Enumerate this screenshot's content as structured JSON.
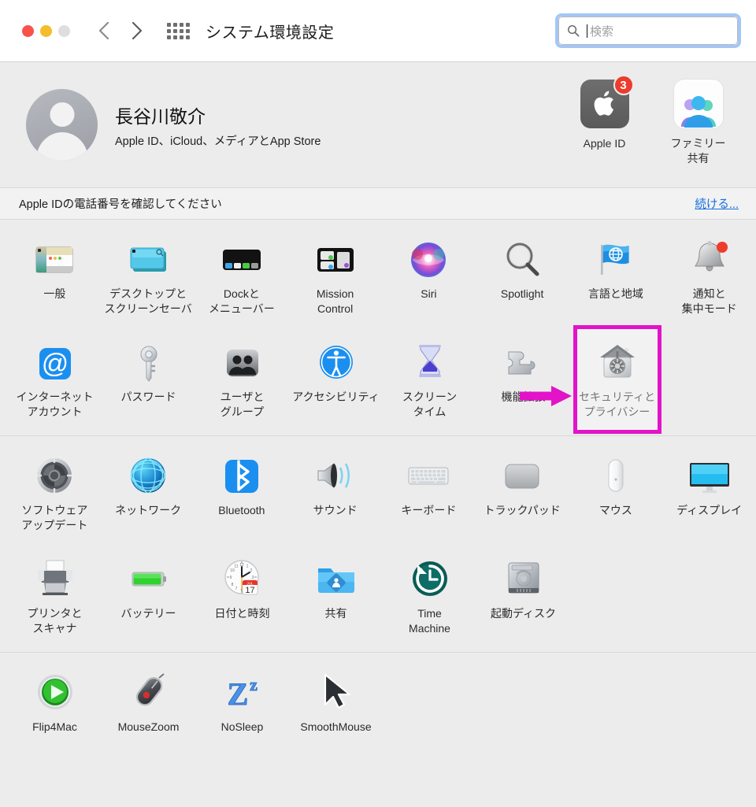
{
  "window": {
    "title": "システム環境設定",
    "traffic_lights": [
      "close-red",
      "minimize-yellow",
      "zoom-gray-disabled"
    ],
    "nav": {
      "back": "back-chevron",
      "forward": "forward-chevron",
      "grid": "show-all-grid"
    }
  },
  "search": {
    "placeholder": "検索",
    "value": "",
    "icon": "search-icon",
    "focus_ring_color": "#a3c7f5"
  },
  "account": {
    "name": "長谷川敬介",
    "subtitle": "Apple ID、iCloud、メディアとApp Store",
    "avatar": "user-placeholder-avatar",
    "apps": [
      {
        "label": "Apple ID",
        "icon": "apple-logo-icon",
        "badge": "3",
        "badge_color": "#ec3c2d"
      },
      {
        "label": "ファミリー\n共有",
        "label_line1": "ファミリー",
        "label_line2": "共有",
        "icon": "family-sharing-icon"
      }
    ]
  },
  "notice": {
    "message": "Apple IDの電話番号を確認してください",
    "action_label": "続ける...",
    "action_color": "#156ce0"
  },
  "annotation": {
    "highlight_target": "セキュリティとプライバシー",
    "highlight_color": "#e213c8",
    "arrow": "right-arrow-annotation"
  },
  "sections": [
    {
      "name": "system-core",
      "rows": [
        [
          {
            "label_line1": "一般",
            "label_line2": "",
            "icon": "general-window-icon"
          },
          {
            "label_line1": "デスクトップと",
            "label_line2": "スクリーンセーバ",
            "icon": "desktop-screensaver-icon"
          },
          {
            "label_line1": "Dockと",
            "label_line2": "メニューバー",
            "icon": "dock-menubar-icon"
          },
          {
            "label_line1": "Mission",
            "label_line2": "Control",
            "icon": "mission-control-icon"
          },
          {
            "label_line1": "Siri",
            "label_line2": "",
            "icon": "siri-icon"
          },
          {
            "label_line1": "Spotlight",
            "label_line2": "",
            "icon": "spotlight-magnifier-icon"
          },
          {
            "label_line1": "言語と地域",
            "label_line2": "",
            "icon": "language-region-flag-icon"
          },
          {
            "label_line1": "通知と",
            "label_line2": "集中モード",
            "icon": "notifications-bell-icon"
          }
        ],
        [
          {
            "label_line1": "インターネット",
            "label_line2": "アカウント",
            "icon": "internet-accounts-at-icon"
          },
          {
            "label_line1": "パスワード",
            "label_line2": "",
            "icon": "passwords-key-icon"
          },
          {
            "label_line1": "ユーザと",
            "label_line2": "グループ",
            "icon": "users-groups-icon"
          },
          {
            "label_line1": "アクセシビリティ",
            "label_line2": "",
            "icon": "accessibility-icon"
          },
          {
            "label_line1": "スクリーン",
            "label_line2": "タイム",
            "icon": "screen-time-hourglass-icon"
          },
          {
            "label_line1": "機能拡張",
            "label_line2": "",
            "icon": "extensions-puzzle-icon"
          },
          {
            "label_line1": "セキュリティと",
            "label_line2": "プライバシー",
            "icon": "security-privacy-house-safe-icon",
            "highlighted": true
          }
        ]
      ]
    },
    {
      "name": "hardware",
      "rows": [
        [
          {
            "label_line1": "ソフトウェア",
            "label_line2": "アップデート",
            "icon": "software-update-gear-icon"
          },
          {
            "label_line1": "ネットワーク",
            "label_line2": "",
            "icon": "network-globe-icon"
          },
          {
            "label_line1": "Bluetooth",
            "label_line2": "",
            "icon": "bluetooth-icon"
          },
          {
            "label_line1": "サウンド",
            "label_line2": "",
            "icon": "sound-speaker-icon"
          },
          {
            "label_line1": "キーボード",
            "label_line2": "",
            "icon": "keyboard-icon"
          },
          {
            "label_line1": "トラックパッド",
            "label_line2": "",
            "icon": "trackpad-icon"
          },
          {
            "label_line1": "マウス",
            "label_line2": "",
            "icon": "mouse-icon"
          },
          {
            "label_line1": "ディスプレイ",
            "label_line2": "",
            "icon": "display-monitor-icon"
          }
        ],
        [
          {
            "label_line1": "プリンタと",
            "label_line2": "スキャナ",
            "icon": "printer-scanner-icon"
          },
          {
            "label_line1": "バッテリー",
            "label_line2": "",
            "icon": "battery-icon"
          },
          {
            "label_line1": "日付と時刻",
            "label_line2": "",
            "icon": "date-time-clock-icon",
            "icon_detail": {
              "month": "JUL",
              "day": "17"
            }
          },
          {
            "label_line1": "共有",
            "label_line2": "",
            "icon": "sharing-folder-icon"
          },
          {
            "label_line1": "Time",
            "label_line2": "Machine",
            "icon": "time-machine-icon"
          },
          {
            "label_line1": "起動ディスク",
            "label_line2": "",
            "icon": "startup-disk-icon"
          }
        ]
      ]
    },
    {
      "name": "third-party",
      "rows": [
        [
          {
            "label_line1": "Flip4Mac",
            "label_line2": "",
            "icon": "flip4mac-play-icon"
          },
          {
            "label_line1": "MouseZoom",
            "label_line2": "",
            "icon": "mousezoom-icon"
          },
          {
            "label_line1": "NoSleep",
            "label_line2": "",
            "icon": "nosleep-zz-icon"
          },
          {
            "label_line1": "SmoothMouse",
            "label_line2": "",
            "icon": "smoothmouse-cursor-icon"
          }
        ]
      ]
    }
  ]
}
